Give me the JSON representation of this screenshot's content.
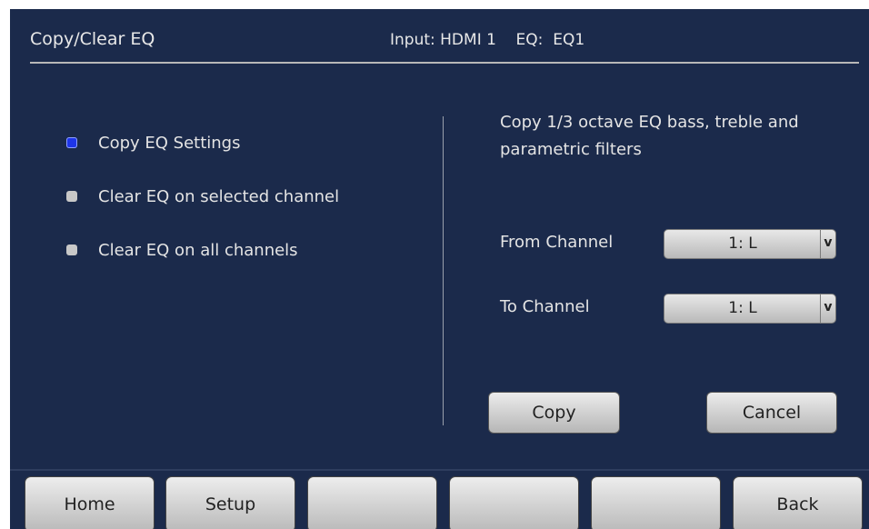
{
  "header": {
    "title": "Copy/Clear EQ",
    "input_info": "Input: HDMI 1    EQ:  EQ1"
  },
  "options": [
    {
      "label": "Copy EQ Settings",
      "selected": true
    },
    {
      "label": "Clear EQ on selected channel",
      "selected": false
    },
    {
      "label": "Clear EQ on all channels",
      "selected": false
    }
  ],
  "description": "Copy 1/3 octave EQ bass, treble and parametric filters",
  "from_channel": {
    "label": "From Channel",
    "value": "1: L",
    "arrow": "v"
  },
  "to_channel": {
    "label": "To Channel",
    "value": "1: L",
    "arrow": "v"
  },
  "actions": {
    "copy": "Copy",
    "cancel": "Cancel"
  },
  "nav": [
    "Home",
    "Setup",
    "",
    "",
    "",
    "Back"
  ],
  "colors": {
    "background": "#1b2a4b",
    "selected_radio": "#1e35e8"
  }
}
